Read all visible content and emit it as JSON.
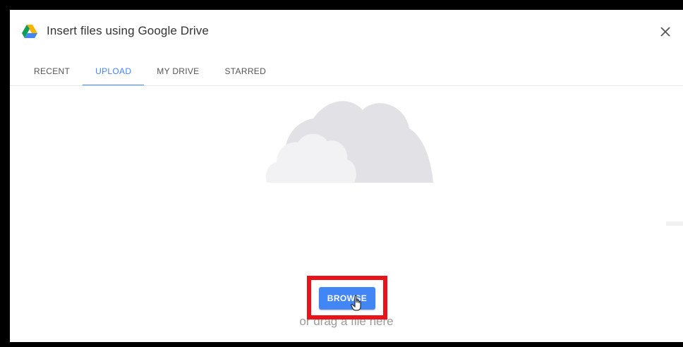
{
  "dialog": {
    "title": "Insert files using Google Drive",
    "close_icon": "close-icon",
    "logo_icon": "google-drive-logo"
  },
  "tabs": [
    {
      "label": "RECENT",
      "active": false
    },
    {
      "label": "UPLOAD",
      "active": true
    },
    {
      "label": "MY DRIVE",
      "active": false
    },
    {
      "label": "STARRED",
      "active": false
    }
  ],
  "upload": {
    "browse_label": "BROWSE",
    "drag_text": "or drag a file here",
    "illustration": "cloud-icon"
  },
  "colors": {
    "accent": "#4285f4",
    "highlight": "#e8141a",
    "drive_green": "#0f9d58",
    "drive_yellow": "#f4b400",
    "drive_blue": "#4285f4"
  }
}
